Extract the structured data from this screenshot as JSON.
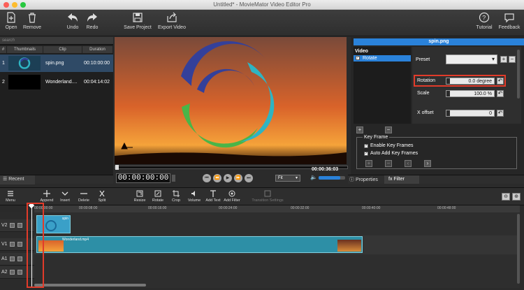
{
  "window": {
    "title": "Untitled* - MovieMator Video Editor Pro"
  },
  "toolbar": {
    "open": "Open",
    "remove": "Remove",
    "undo": "Undo",
    "redo": "Redo",
    "save_project": "Save Project",
    "export_video": "Export Video",
    "tutorial": "Tutorial",
    "feedback": "Feedback"
  },
  "media": {
    "search_placeholder": "search",
    "columns": [
      "#",
      "Thumbnails",
      "Clip",
      "Duration"
    ],
    "rows": [
      {
        "num": "1",
        "clip": "spin.png",
        "duration": "00:10:00:00"
      },
      {
        "num": "2",
        "clip": "Wonderland....",
        "duration": "00:04:14:02"
      }
    ],
    "recent_tab": "Recent"
  },
  "preview": {
    "current_time": "00:00:00:00",
    "total_time": "00:00:36:03",
    "zoom": "Fit",
    "volume_level": 0.82
  },
  "filters": {
    "clip_name": "spin.png",
    "category": "Video",
    "filter_item": "Rotate",
    "preset_label": "Preset",
    "rotation_label": "Rotation",
    "rotation_value": "0.0 degree",
    "scale_label": "Scale",
    "scale_value": "100.0 %",
    "xoffset_label": "X offset",
    "xoffset_value": "0",
    "keyframe_title": "Key Frame",
    "enable_keyframes": "Enable Key Frames",
    "auto_add_keyframes": "Auto Add Key Frames",
    "tab_properties": "Properties",
    "tab_filter": "Filter"
  },
  "timeline_toolbar": {
    "menu": "Menu",
    "append": "Append",
    "insert": "Insert",
    "delete": "Delete",
    "split": "Split",
    "resize": "Resize",
    "rotate": "Rotate",
    "crop": "Crop",
    "volume": "Volume",
    "add_text": "Add Text",
    "add_filter": "Add Filter",
    "transition_settings": "Transition Settings"
  },
  "ruler": [
    "00:00:00:00",
    "00:00:08:00",
    "00:00:16:00",
    "00:00:24:00",
    "00:00:32:00",
    "00:00:40:00",
    "00:00:48:00"
  ],
  "tracks": [
    {
      "name": "V2",
      "clip": "spin"
    },
    {
      "name": "V1",
      "clip": "Wonderland.mp4"
    },
    {
      "name": "A1",
      "clip": ""
    },
    {
      "name": "A2",
      "clip": ""
    }
  ],
  "colors": {
    "accent": "#2a82da",
    "highlight_box": "#e23b2a",
    "clip": "#2d8fa6"
  }
}
